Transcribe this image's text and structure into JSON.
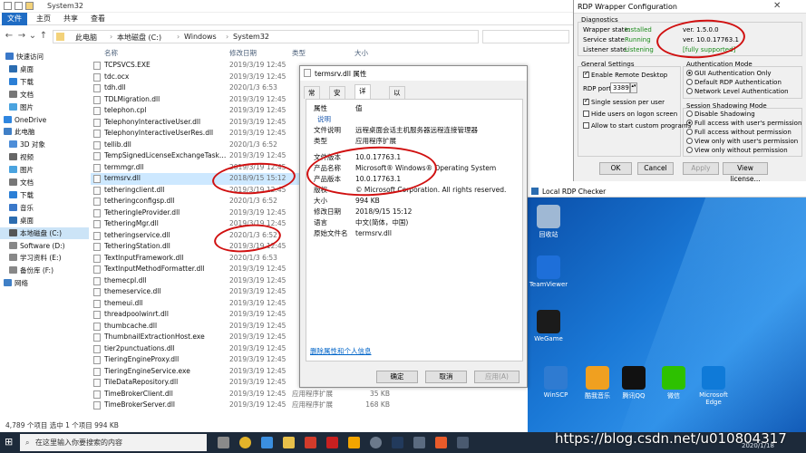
{
  "explorer": {
    "title": "System32",
    "ribbon_tabs": [
      "文件",
      "主页",
      "共享",
      "查看"
    ],
    "breadcrumb": [
      "此电脑",
      "本地磁盘 (C:)",
      "Windows",
      "System32"
    ],
    "columns": [
      "名称",
      "修改日期",
      "类型",
      "大小"
    ],
    "nav": [
      "快速访问",
      "桌面",
      "下载",
      "文档",
      "图片",
      "OneDrive",
      "此电脑",
      "3D 对象",
      "视频",
      "图片",
      "文档",
      "下载",
      "音乐",
      "桌面",
      "本地磁盘 (C:)",
      "Software (D:)",
      "学习资料 (E:)",
      "备份库 (F:)",
      "网络"
    ],
    "files": [
      {
        "name": "TCPSVCS.EXE",
        "date": "2019/3/19 12:45",
        "type": "",
        "size": ""
      },
      {
        "name": "tdc.ocx",
        "date": "2019/3/19 12:45",
        "type": "",
        "size": ""
      },
      {
        "name": "tdh.dll",
        "date": "2020/1/3 6:53",
        "type": "",
        "size": ""
      },
      {
        "name": "TDLMigration.dll",
        "date": "2019/3/19 12:45",
        "type": "",
        "size": ""
      },
      {
        "name": "telephon.cpl",
        "date": "2019/3/19 12:45",
        "type": "",
        "size": ""
      },
      {
        "name": "TelephonyInteractiveUser.dll",
        "date": "2019/3/19 12:45",
        "type": "",
        "size": ""
      },
      {
        "name": "TelephonyInteractiveUserRes.dll",
        "date": "2019/3/19 12:45",
        "type": "",
        "size": ""
      },
      {
        "name": "tellib.dll",
        "date": "2020/1/3 6:52",
        "type": "",
        "size": ""
      },
      {
        "name": "TempSignedLicenseExchangeTask.dll",
        "date": "2019/3/19 12:45",
        "type": "",
        "size": ""
      },
      {
        "name": "termmgr.dll",
        "date": "2019/3/19 12:45",
        "type": "",
        "size": ""
      },
      {
        "name": "termsrv.dll",
        "date": "2018/9/15 15:12",
        "type": "",
        "size": ""
      },
      {
        "name": "tetheringclient.dll",
        "date": "2019/3/19 12:45",
        "type": "",
        "size": ""
      },
      {
        "name": "tetheringconfigsp.dll",
        "date": "2020/1/3 6:52",
        "type": "",
        "size": ""
      },
      {
        "name": "TetheringIeProvider.dll",
        "date": "2019/3/19 12:45",
        "type": "",
        "size": ""
      },
      {
        "name": "TetheringMgr.dll",
        "date": "2019/3/19 12:45",
        "type": "",
        "size": ""
      },
      {
        "name": "tetheringservice.dll",
        "date": "2020/1/3 6:52",
        "type": "",
        "size": ""
      },
      {
        "name": "TetheringStation.dll",
        "date": "2019/3/19 12:45",
        "type": "",
        "size": ""
      },
      {
        "name": "TextInputFramework.dll",
        "date": "2020/1/3 6:53",
        "type": "",
        "size": ""
      },
      {
        "name": "TextInputMethodFormatter.dll",
        "date": "2019/3/19 12:45",
        "type": "",
        "size": ""
      },
      {
        "name": "themecpl.dll",
        "date": "2019/3/19 12:45",
        "type": "",
        "size": ""
      },
      {
        "name": "themeservice.dll",
        "date": "2019/3/19 12:45",
        "type": "",
        "size": ""
      },
      {
        "name": "themeui.dll",
        "date": "2019/3/19 12:45",
        "type": "",
        "size": ""
      },
      {
        "name": "threadpoolwinrt.dll",
        "date": "2019/3/19 12:45",
        "type": "",
        "size": ""
      },
      {
        "name": "thumbcache.dll",
        "date": "2019/3/19 12:45",
        "type": "",
        "size": ""
      },
      {
        "name": "ThumbnailExtractionHost.exe",
        "date": "2019/3/19 12:45",
        "type": "",
        "size": ""
      },
      {
        "name": "tier2punctuations.dll",
        "date": "2019/3/19 12:45",
        "type": "",
        "size": ""
      },
      {
        "name": "TieringEngineProxy.dll",
        "date": "2019/3/19 12:45",
        "type": "",
        "size": ""
      },
      {
        "name": "TieringEngineService.exe",
        "date": "2019/3/19 12:45",
        "type": "",
        "size": ""
      },
      {
        "name": "TileDataRepository.dll",
        "date": "2019/3/19 12:45",
        "type": "",
        "size": ""
      },
      {
        "name": "TimeBrokerClient.dll",
        "date": "2019/3/19 12:45",
        "type": "应用程序扩展",
        "size": "35 KB"
      },
      {
        "name": "TimeBrokerServer.dll",
        "date": "2019/3/19 12:45",
        "type": "应用程序扩展",
        "size": "168 KB"
      }
    ],
    "status": "4,789 个项目    选中 1 个项目  994 KB"
  },
  "props": {
    "title": "termsrv.dll 属性",
    "tabs": [
      "常规",
      "安全",
      "详细信息",
      "以前的版本"
    ],
    "head_k": "属性",
    "head_v": "值",
    "section": "说明",
    "rows": [
      {
        "k": "文件说明",
        "v": "远程桌面会话主机服务器远程连接管理器"
      },
      {
        "k": "类型",
        "v": "应用程序扩展"
      },
      {
        "k": "文件版本",
        "v": "10.0.17763.1"
      },
      {
        "k": "产品名称",
        "v": "Microsoft® Windows® Operating System"
      },
      {
        "k": "产品版本",
        "v": "10.0.17763.1"
      },
      {
        "k": "版权",
        "v": "© Microsoft Corporation. All rights reserved."
      },
      {
        "k": "大小",
        "v": "994 KB"
      },
      {
        "k": "修改日期",
        "v": "2018/9/15 15:12"
      },
      {
        "k": "语言",
        "v": "中文(简体，中国)"
      },
      {
        "k": "原始文件名",
        "v": "termsrv.dll"
      }
    ],
    "remove_link": "删除属性和个人信息",
    "ok": "确定",
    "cancel": "取消",
    "apply": "应用(A)"
  },
  "rdp": {
    "title": "RDP Wrapper Configuration",
    "diag": "Diagnostics",
    "wrapper_k": "Wrapper state:",
    "wrapper_s": "Installed",
    "wrapper_v": "ver. 1.5.0.0",
    "service_k": "Service state:",
    "service_s": "Running",
    "service_v": "ver. 10.0.17763.1",
    "listener_k": "Listener state:",
    "listener_s": "Listening",
    "listener_v": "[fully supported]",
    "gs": "General Settings",
    "enable": "Enable Remote Desktop",
    "port_k": "RDP port:",
    "port_v": "3389",
    "single": "Single session per user",
    "hide": "Hide users on logon screen",
    "allow": "Allow to start custom programs",
    "auth": "Authentication Mode",
    "a1": "GUI Authentication Only",
    "a2": "Default RDP Authentication",
    "a3": "Network Level Authentication",
    "shadow": "Session Shadowing Mode",
    "s1": "Disable Shadowing",
    "s2": "Full access with user's permission",
    "s3": "Full access without permission",
    "s4": "View only with user's permission",
    "s5": "View only without permission",
    "ok": "OK",
    "cancel": "Cancel",
    "apply": "Apply",
    "license": "View license..."
  },
  "checker_title": "Local RDP Checker",
  "desktop_icons": [
    "回收站",
    "TeamViewer",
    "WeGame",
    "WinSCP",
    "酷我音乐",
    "腾讯QQ",
    "微信",
    "Microsoft Edge"
  ],
  "taskbar": {
    "search": "在这里输入你要搜索的内容",
    "date": "2020/1/18"
  },
  "watermark": "https://blog.csdn.net/u010804317"
}
